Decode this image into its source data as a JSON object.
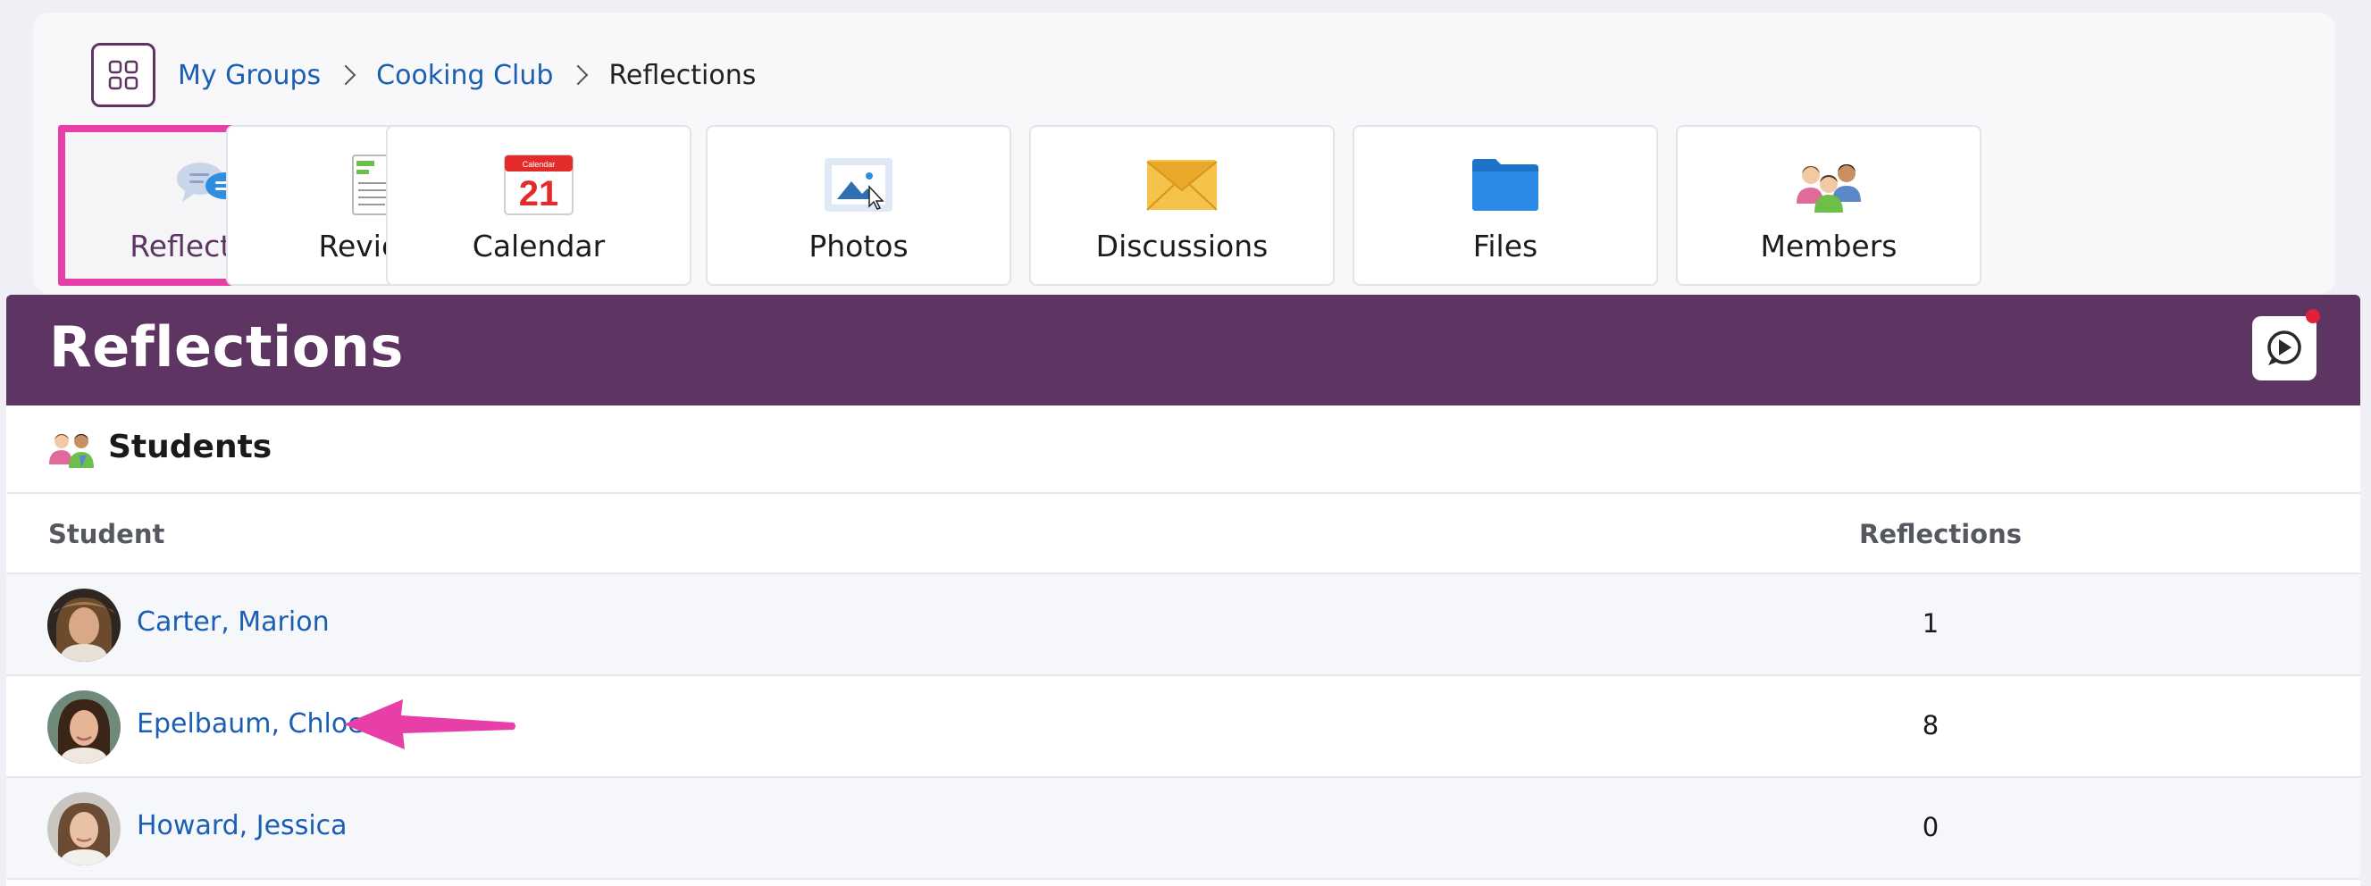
{
  "breadcrumb": {
    "items": [
      {
        "label": "My Groups",
        "link": true
      },
      {
        "label": "Cooking Club",
        "link": true
      },
      {
        "label": "Reflections",
        "link": false
      }
    ]
  },
  "tiles": [
    {
      "label": "Reflections",
      "icon": "speech-bubbles-icon",
      "active": true
    },
    {
      "label": "Reviews",
      "icon": "notepad-pencil-icon",
      "active": false
    },
    {
      "label": "Calendar",
      "icon": "calendar-icon",
      "active": false
    },
    {
      "label": "Photos",
      "icon": "photo-icon",
      "active": false
    },
    {
      "label": "Discussions",
      "icon": "envelope-icon",
      "active": false
    },
    {
      "label": "Files",
      "icon": "folder-icon",
      "active": false
    },
    {
      "label": "Members",
      "icon": "people-icon",
      "active": false
    }
  ],
  "calendar_icon_text": {
    "month": "Calendar",
    "day": "21"
  },
  "header": {
    "title": "Reflections"
  },
  "students_section": {
    "title": "Students",
    "columns": {
      "student": "Student",
      "reflections": "Reflections"
    },
    "rows": [
      {
        "name": "Carter, Marion",
        "reflections": "1"
      },
      {
        "name": "Epelbaum, Chloe",
        "reflections": "8"
      },
      {
        "name": "Howard, Jessica",
        "reflections": "0"
      }
    ]
  },
  "colors": {
    "brand_purple": "#5d3462",
    "link_blue": "#1a5fb4",
    "highlight_pink": "#e83ea8",
    "notification_red": "#e2203a"
  }
}
